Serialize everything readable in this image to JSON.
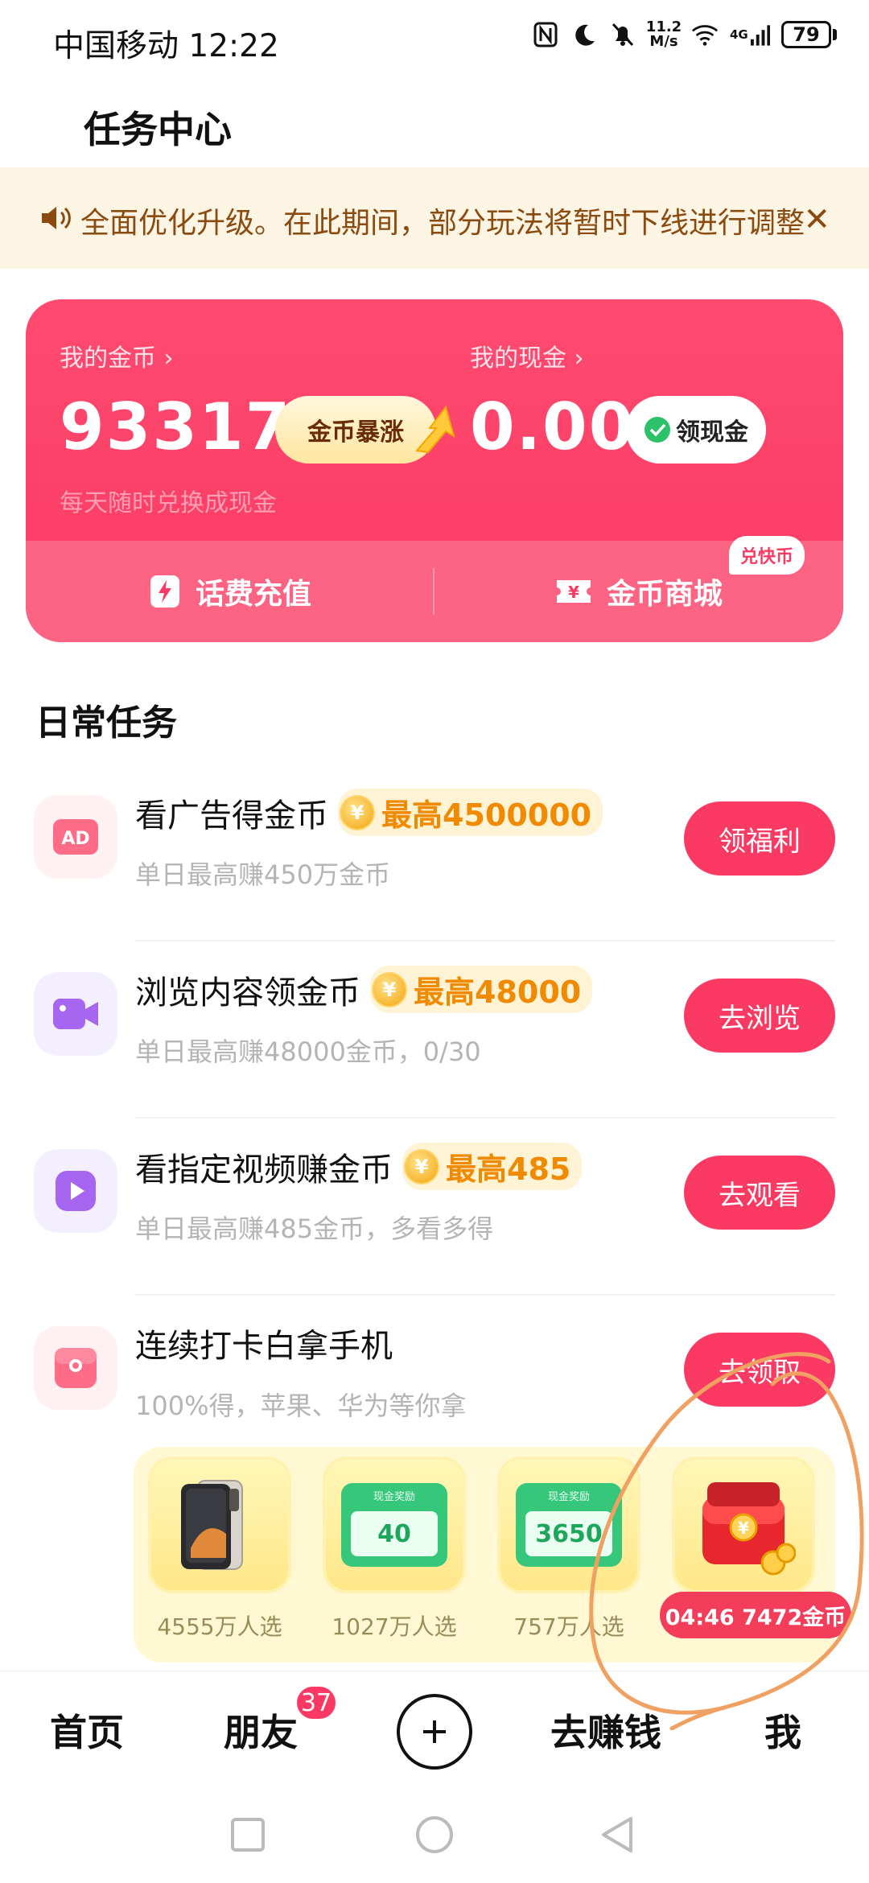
{
  "status_bar": {
    "carrier_time": "中国移动 12:22",
    "speed": "11.2\nM/s",
    "network": "4G",
    "battery": "79",
    "icons": [
      "nfc-icon",
      "moon-icon",
      "bell-off-icon",
      "wifi-icon",
      "signal-icon",
      "battery-icon"
    ]
  },
  "header": {
    "title": "任务中心"
  },
  "notice": {
    "text": "全面优化升级。在此期间，部分玩法将暂时下线进行调整",
    "icon": "speaker-icon",
    "close_icon": "close-icon"
  },
  "wallet": {
    "coins_label": "我的金币 ›",
    "coins_value": "93317",
    "coins_pill": "金币暴涨",
    "coins_sub": "每天随时兑换成现金",
    "cash_label": "我的现金 ›",
    "cash_value": "0.00",
    "cash_pill": "领现金",
    "recharge": "话费充值",
    "mall": "金币商城",
    "mall_tag": "兑快币"
  },
  "tasks_section": {
    "title": "日常任务"
  },
  "tasks": [
    {
      "title": "看广告得金币",
      "badge": "最高4500000",
      "sub": "单日最高赚450万金币",
      "button": "领福利",
      "icon": "ad-icon"
    },
    {
      "title": "浏览内容领金币",
      "badge": "最高48000",
      "sub": "单日最高赚48000金币，0/30",
      "button": "去浏览",
      "icon": "video-camera-icon"
    },
    {
      "title": "看指定视频赚金币",
      "badge": "最高485",
      "sub": "单日最高赚485金币，多看多得",
      "button": "去观看",
      "icon": "play-icon"
    },
    {
      "title": "连续打卡白拿手机",
      "sub": "100%得，苹果、华为等你拿",
      "button": "去领取",
      "icon": "gift-box-icon"
    }
  ],
  "prizes": [
    {
      "caption": "4555万人选",
      "kind": "phone"
    },
    {
      "caption": "1027万人选",
      "kind": "cash",
      "card_title": "现金奖励",
      "amount": "40"
    },
    {
      "caption": "757万人选",
      "kind": "cash",
      "card_title": "现金奖励",
      "amount": "3650"
    },
    {
      "caption": "04:46 7472金币",
      "kind": "chest"
    }
  ],
  "bottom_nav": {
    "home": "首页",
    "friends": "朋友",
    "friends_badge": "37",
    "earn": "去赚钱",
    "me": "我"
  },
  "colors": {
    "brand_red": "#fa3a63",
    "notice_bg": "#fdf5e4",
    "notice_text": "#8a4a10",
    "annotation_orange": "#f0a060"
  }
}
